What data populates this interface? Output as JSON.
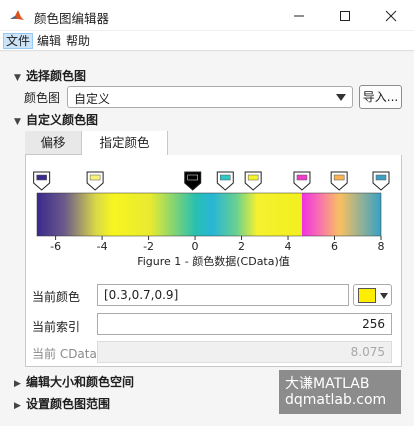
{
  "window": {
    "title": "颜色图编辑器",
    "controls": [
      "minimize",
      "maximize",
      "close"
    ]
  },
  "menubar": {
    "items": [
      {
        "label": "文件",
        "active": true
      },
      {
        "label": "编辑",
        "active": false
      },
      {
        "label": "帮助",
        "active": false
      }
    ]
  },
  "select_colormap": {
    "header": "选择颜色图",
    "label": "颜色图",
    "value": "自定义",
    "import_button": "导入..."
  },
  "custom_colormap": {
    "header": "自定义颜色图",
    "tabs": [
      {
        "label": "偏移",
        "selected": false
      },
      {
        "label": "指定颜色",
        "selected": true
      }
    ],
    "colorbar": {
      "ticks": [
        "-6",
        "-4",
        "-2",
        "0",
        "2",
        "4",
        "6",
        "8"
      ],
      "caption": "Figure 1 - 颜色数据(CData)值",
      "range": [
        -6.8,
        8
      ],
      "markers": [
        {
          "value": -6.6,
          "color": "#3a2a8c",
          "selected": false
        },
        {
          "value": -4.3,
          "color": "#f8f27a",
          "selected": false
        },
        {
          "value": -0.1,
          "color": "#000000",
          "selected": true
        },
        {
          "value": 1.3,
          "color": "#2cc7c7",
          "selected": false
        },
        {
          "value": 4.6,
          "color": "#ef3bc8",
          "selected": false
        },
        {
          "value": 6.2,
          "color": "#f9b350",
          "selected": false
        },
        {
          "value": 2.5,
          "color": "#f7f32a",
          "selected": false
        },
        {
          "value": 8.0,
          "color": "#3ca0c4",
          "selected": false
        }
      ]
    }
  },
  "current_color": {
    "label": "当前颜色",
    "value": "[0.3,0.7,0.9]",
    "swatch": "#ffee00"
  },
  "current_index": {
    "label": "当前索引",
    "value": "256"
  },
  "current_cdata": {
    "label": "当前 CData",
    "value": "8.075"
  },
  "collapsed_sections": [
    {
      "header": "编辑大小和颜色空间"
    },
    {
      "header": "设置颜色图范围"
    }
  ],
  "watermark": {
    "line1": "大谦MATLAB",
    "line2": "dqmatlab.com"
  }
}
